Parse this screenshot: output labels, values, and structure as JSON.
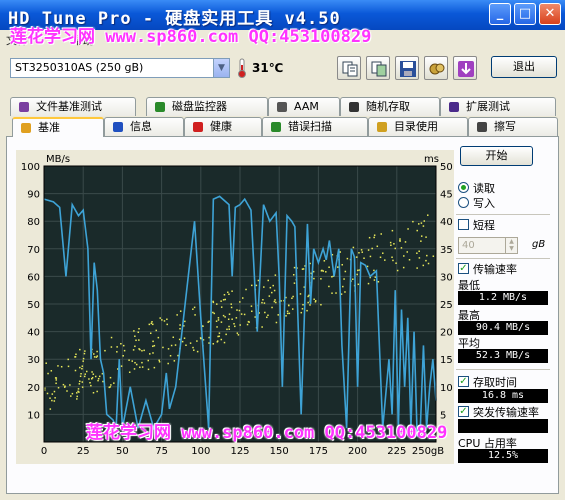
{
  "window": {
    "title": "HD Tune Pro - 硬盘实用工具 v4.50"
  },
  "menu": {
    "file": "文件",
    "help": "帮助"
  },
  "watermark": {
    "top": "莲花学习网 www.sp860.com QQ:453100829",
    "bottom": "莲花学习网 www.sp860.com QQ:453100829"
  },
  "toolbar": {
    "drive": "ST3250310AS (250 gB)",
    "temperature": "31℃",
    "exit_label": "退出"
  },
  "icons": {
    "thermometer": "thermometer-icon",
    "copy_text": "copy-text-icon",
    "copy_screen": "copy-screen-icon",
    "save": "save-icon",
    "options": "options-icon",
    "download": "download-icon"
  },
  "tabs_row1": [
    {
      "label": "文件基准测试",
      "icon": "file-benchmark-icon"
    },
    {
      "label": "磁盘监控器",
      "icon": "disk-monitor-icon"
    },
    {
      "label": "AAM",
      "icon": "speaker-icon"
    },
    {
      "label": "随机存取",
      "icon": "random-access-icon"
    },
    {
      "label": "扩展测试",
      "icon": "extra-tests-icon"
    }
  ],
  "tabs_row2": [
    {
      "label": "基准",
      "icon": "benchmark-icon"
    },
    {
      "label": "信息",
      "icon": "info-icon"
    },
    {
      "label": "健康",
      "icon": "health-icon"
    },
    {
      "label": "错误扫描",
      "icon": "error-scan-icon"
    },
    {
      "label": "目录使用",
      "icon": "folder-usage-icon"
    },
    {
      "label": "擦写",
      "icon": "erase-icon"
    }
  ],
  "controls": {
    "start": "开始",
    "read": "读取",
    "write": "写入",
    "short": "短程",
    "short_value": "40",
    "short_unit": "gB",
    "transfer_rate": "传输速率",
    "min_label": "最低",
    "min_value": "1.2 MB/s",
    "max_label": "最高",
    "max_value": "90.4 MB/s",
    "avg_label": "平均",
    "avg_value": "52.3 MB/s",
    "access_time": "存取时间",
    "access_value": "16.8 ms",
    "burst_rate": "突发传输速率",
    "burst_value": "",
    "cpu_label": "CPU 占用率",
    "cpu_value": "12.5%"
  },
  "colors": {
    "transfer_line": "#3ea3d6",
    "access_dots": "#e8e85a",
    "plot_bg": "#1a2a2a",
    "grid": "#3a4a4a",
    "watermark": "#ff33ff"
  },
  "chart_data": {
    "type": "line",
    "ylabel_left": "MB/s",
    "ylabel_right": "ms",
    "x_unit": "gB",
    "x_ticks": [
      "0",
      "25",
      "50",
      "75",
      "100",
      "125",
      "150",
      "175",
      "200",
      "225",
      "250"
    ],
    "y_left_ticks": [
      "100",
      "90",
      "80",
      "70",
      "60",
      "50",
      "40",
      "30",
      "20",
      "10"
    ],
    "y_right_ticks": [
      "50",
      "45",
      "40",
      "35",
      "30",
      "25",
      "20",
      "15",
      "10",
      "5"
    ],
    "xlim": [
      0,
      250
    ],
    "ylim_left": [
      0,
      100
    ],
    "ylim_right": [
      0,
      50
    ],
    "grid": true,
    "series": [
      {
        "values_x": [
          0,
          6,
          10,
          14,
          18,
          22,
          25,
          28,
          30,
          32,
          34,
          36,
          38,
          40,
          44,
          46,
          48,
          50,
          55,
          60,
          65,
          70,
          75,
          78,
          80,
          84,
          88,
          92,
          96,
          100,
          105,
          108,
          112,
          116,
          118,
          120,
          122,
          125,
          128,
          132,
          136,
          140,
          144,
          148,
          150,
          152,
          155,
          158,
          160,
          164,
          168,
          170,
          172,
          175,
          178,
          180,
          182,
          185,
          188,
          190,
          193,
          196,
          198,
          200,
          202,
          205,
          208,
          212,
          216,
          220,
          222,
          224,
          226,
          228,
          230,
          232,
          234,
          236,
          238,
          240,
          242,
          244,
          246,
          248,
          250
        ],
        "values_y": [
          88,
          87,
          85,
          60,
          86,
          82,
          84,
          70,
          30,
          65,
          55,
          30,
          25,
          10,
          8,
          5,
          30,
          5,
          20,
          5,
          15,
          5,
          10,
          25,
          12,
          20,
          40,
          60,
          80,
          45,
          5,
          88,
          89,
          87,
          86,
          60,
          85,
          86,
          88,
          84,
          40,
          86,
          80,
          83,
          60,
          20,
          82,
          80,
          78,
          10,
          79,
          50,
          70,
          65,
          70,
          66,
          73,
          60,
          70,
          35,
          5,
          70,
          67,
          20,
          65,
          64,
          60,
          62,
          5,
          30,
          10,
          55,
          5,
          48,
          20,
          45,
          5,
          40,
          2,
          5,
          35,
          5,
          20,
          30,
          15
        ]
      },
      {
        "name_axis": "ms",
        "count": 2000
      }
    ]
  }
}
